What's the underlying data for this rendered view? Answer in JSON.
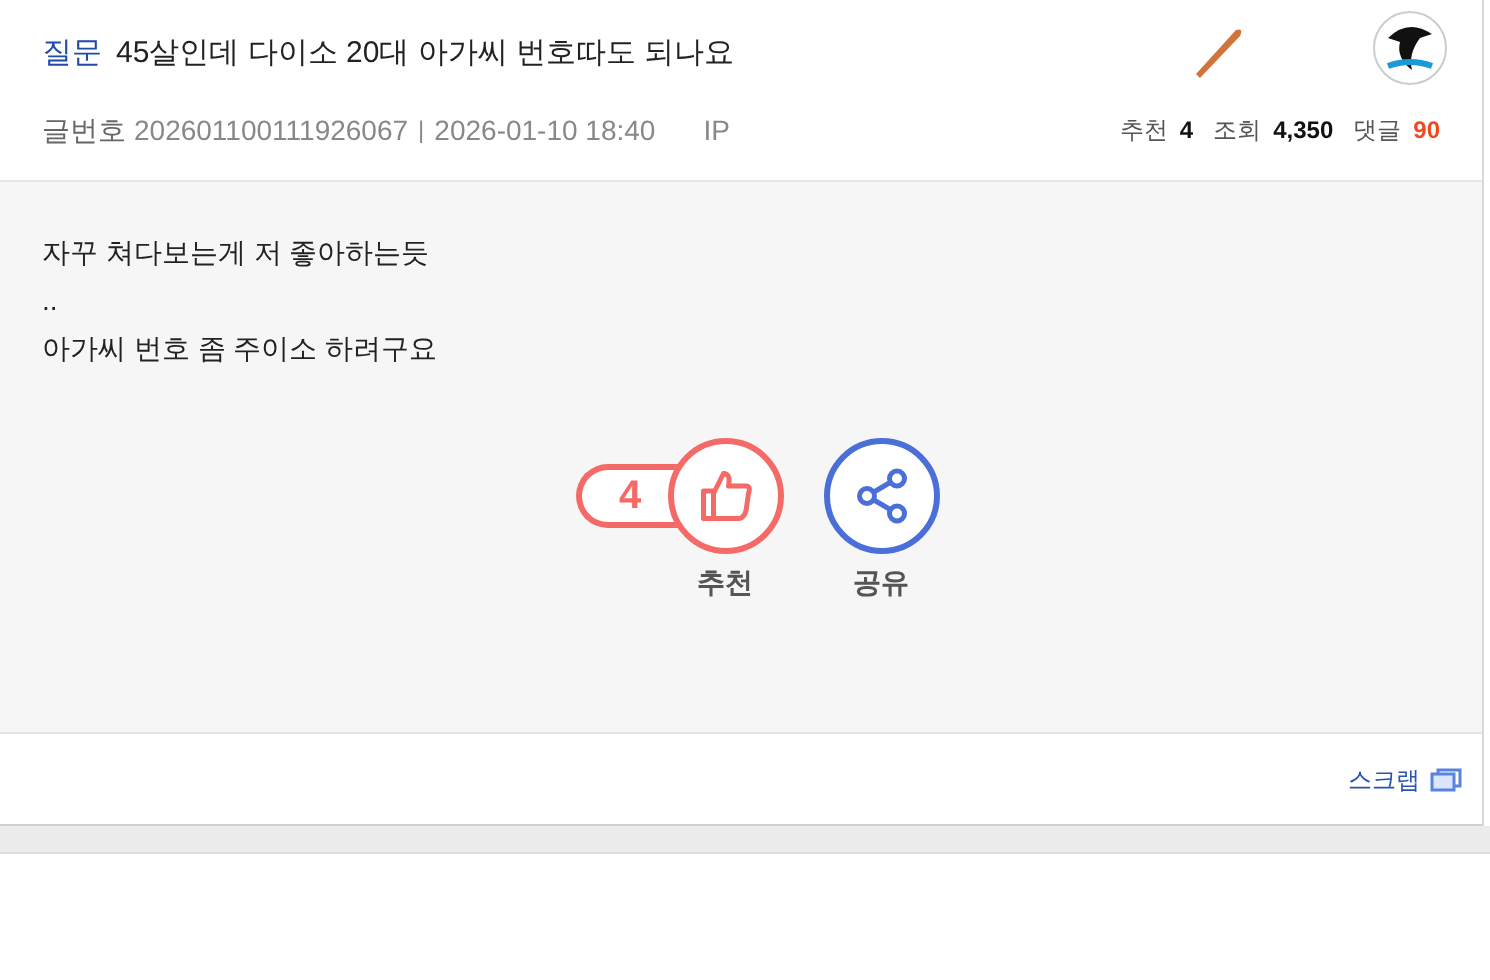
{
  "post": {
    "category": "질문",
    "title": "45살인데 다이소 20대 아가씨 번호따도 되나요",
    "number_label": "글번호",
    "number": "202601100111926067",
    "separator": "|",
    "datetime": "2026-01-10 18:40",
    "ip_label": "IP"
  },
  "stats": [
    {
      "label": "추천",
      "value": "4",
      "kind": "normal"
    },
    {
      "label": "조회",
      "value": "4,350",
      "kind": "normal"
    },
    {
      "label": "댓글",
      "value": "90",
      "kind": "highlight"
    }
  ],
  "body": {
    "lines": [
      "자꾸 쳐다보는게 저 좋아하는듯",
      "..",
      "아가씨 번호 좀 주이소 하려구요"
    ]
  },
  "actions": {
    "recommend": {
      "count": "4",
      "label": "추천"
    },
    "share": {
      "label": "공유"
    }
  },
  "footer": {
    "scrap": "스크랩"
  }
}
